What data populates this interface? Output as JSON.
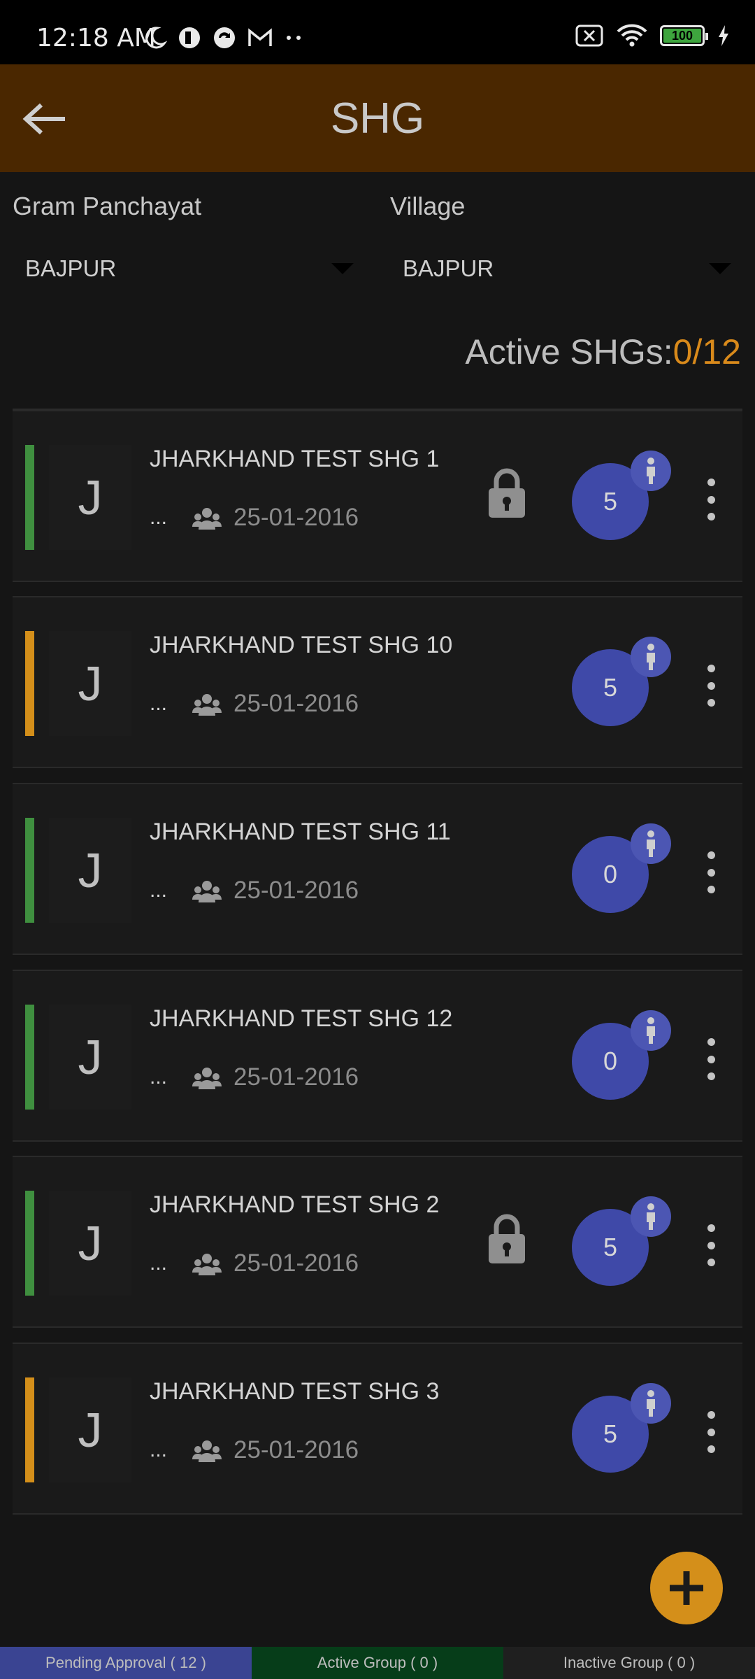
{
  "status_bar": {
    "time": "12:18 AM",
    "battery": "100"
  },
  "app_bar": {
    "title": "SHG",
    "back_icon": "arrow-left-icon"
  },
  "filters": {
    "gram_panchayat": {
      "label": "Gram Panchayat",
      "value": "BAJPUR"
    },
    "village": {
      "label": "Village",
      "value": "BAJPUR"
    }
  },
  "summary": {
    "label": "Active SHGs:",
    "count": "0/12"
  },
  "colors": {
    "app_bar": "#4a2700",
    "accent": "#d48f1a",
    "status_green": "#3f8f3f",
    "status_orange": "#d48f1a",
    "badge": "#3f49a8"
  },
  "shgs": [
    {
      "name": "JHARKHAND TEST SHG 1",
      "initial": "J",
      "dots": "...",
      "date": "25-01-2016",
      "members": "5",
      "locked": true,
      "status": "green"
    },
    {
      "name": "JHARKHAND TEST SHG 10",
      "initial": "J",
      "dots": "...",
      "date": "25-01-2016",
      "members": "5",
      "locked": false,
      "status": "orange"
    },
    {
      "name": "JHARKHAND TEST SHG 11",
      "initial": "J",
      "dots": "...",
      "date": "25-01-2016",
      "members": "0",
      "locked": false,
      "status": "green"
    },
    {
      "name": "JHARKHAND TEST SHG 12",
      "initial": "J",
      "dots": "...",
      "date": "25-01-2016",
      "members": "0",
      "locked": false,
      "status": "green"
    },
    {
      "name": "JHARKHAND TEST SHG 2",
      "initial": "J",
      "dots": "...",
      "date": "25-01-2016",
      "members": "5",
      "locked": true,
      "status": "green"
    },
    {
      "name": "JHARKHAND TEST SHG 3",
      "initial": "J",
      "dots": "...",
      "date": "25-01-2016",
      "members": "5",
      "locked": false,
      "status": "orange"
    }
  ],
  "bottom_tabs": {
    "pending": "Pending Approval ( 12 )",
    "active": "Active Group ( 0 )",
    "inactive": "Inactive Group ( 0 )"
  }
}
